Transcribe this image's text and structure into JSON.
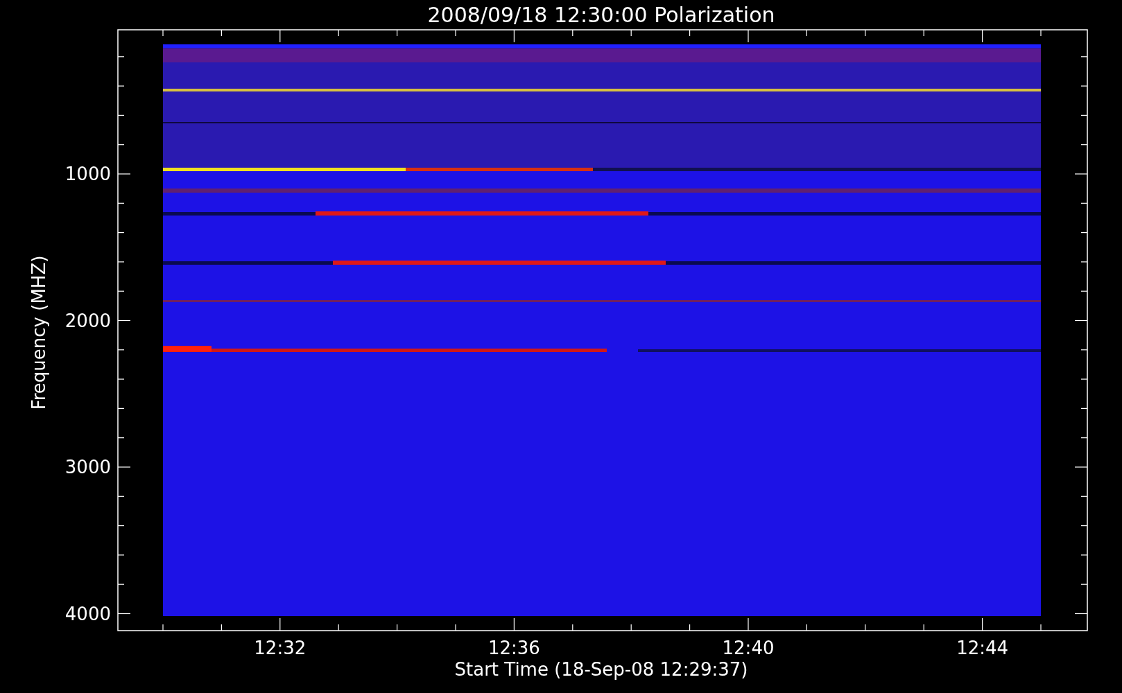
{
  "plot": {
    "title": "2008/09/18 12:30:00 Polarization",
    "xlabel": "Start Time (18-Sep-08 12:29:37)",
    "ylabel": "Frequency (MHZ)",
    "xtick_labels": [
      "12:32",
      "12:36",
      "12:40",
      "12:44"
    ],
    "ytick_labels": [
      "1000",
      "2000",
      "3000",
      "4000"
    ]
  }
}
